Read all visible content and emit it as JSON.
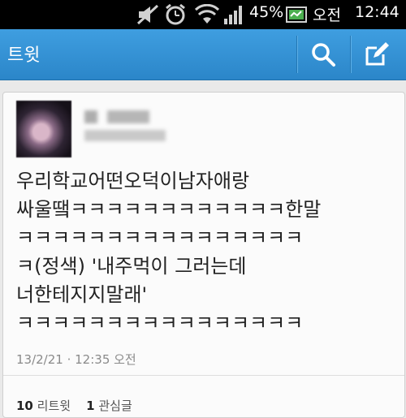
{
  "status_bar": {
    "battery_percent": "45%",
    "ampm": "오전",
    "time": "12:44",
    "icons": [
      "mute-icon",
      "alarm-icon",
      "wifi-icon",
      "signal-icon",
      "battery-icon"
    ]
  },
  "action_bar": {
    "title": "트윗",
    "icons": [
      "search-icon",
      "compose-icon"
    ],
    "color": "#2b86c9"
  },
  "tweet": {
    "text": "우리학교어떤오덕이남자애랑\n싸울땤ㅋㅋㅋㅋㅋㅋㅋㅋㅋㅋㅋㅋ한말\nㅋㅋㅋㅋㅋㅋㅋㅋㅋㅋㅋㅋㅋㅋㅋㅋ\nㅋ(정색) '내주먹이 그러는데\n너한테지지말래'\nㅋㅋㅋㅋㅋㅋㅋㅋㅋㅋㅋㅋㅋㅋㅋㅋ",
    "timestamp": "13/2/21 · 12:35 오전",
    "retweet_count": "10",
    "retweet_label": "리트윗",
    "favorite_count": "1",
    "favorite_label": "관심글"
  }
}
